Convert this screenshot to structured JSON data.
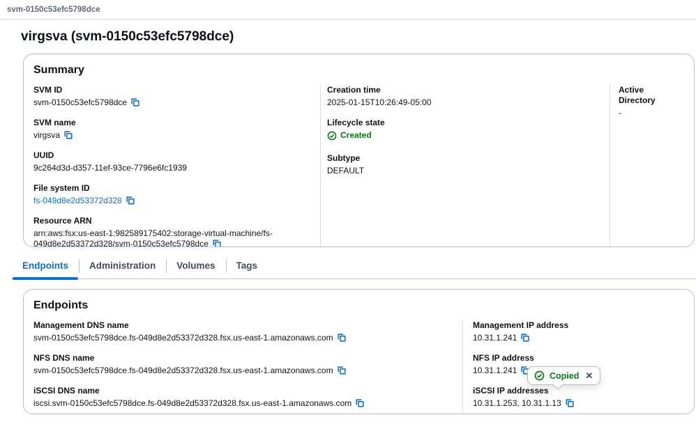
{
  "breadcrumb": {
    "current": "svm-0150c53efc5798dce"
  },
  "page_title": "virgsva (svm-0150c53efc5798dce)",
  "colors": {
    "accent": "#0972d3",
    "success": "#037f0c",
    "text": "#0f141a",
    "secondary_text": "#5f6b7a",
    "card_border": "#b6bec9",
    "divider": "#d9dde3"
  },
  "icons": {
    "copy": "copy-icon (two overlapping squares)",
    "success_check": "check-circle",
    "close": "✕"
  },
  "summary": {
    "heading": "Summary",
    "col1": [
      {
        "label": "SVM ID",
        "value": "svm-0150c53efc5798dce",
        "copy": true
      },
      {
        "label": "SVM name",
        "value": "virgsva",
        "copy": true
      },
      {
        "label": "UUID",
        "value": "9c264d3d-d357-11ef-93ce-7796e6fc1939",
        "copy": false
      },
      {
        "label": "File system ID",
        "value": "fs-049d8e2d53372d328",
        "copy": true,
        "link": true
      },
      {
        "label": "Resource ARN",
        "value": "arn:aws:fsx:us-east-1:982589175402:storage-virtual-machine/fs-049d8e2d53372d328/svm-0150c53efc5798dce",
        "copy": true
      }
    ],
    "col2": [
      {
        "label": "Creation time",
        "value": "2025-01-15T10:26:49-05:00"
      },
      {
        "label": "Lifecycle state",
        "value": "Created",
        "status": "success"
      },
      {
        "label": "Subtype",
        "value": "DEFAULT"
      }
    ],
    "col3": [
      {
        "label": "Active Directory",
        "value": "-"
      }
    ]
  },
  "tabs": [
    {
      "label": "Endpoints",
      "active": true
    },
    {
      "label": "Administration",
      "active": false
    },
    {
      "label": "Volumes",
      "active": false
    },
    {
      "label": "Tags",
      "active": false
    }
  ],
  "endpoints": {
    "heading": "Endpoints",
    "col1": [
      {
        "label": "Management DNS name",
        "value": "svm-0150c53efc5798dce.fs-049d8e2d53372d328.fsx.us-east-1.amazonaws.com",
        "copy": true
      },
      {
        "label": "NFS DNS name",
        "value": "svm-0150c53efc5798dce.fs-049d8e2d53372d328.fsx.us-east-1.amazonaws.com",
        "copy": true
      },
      {
        "label": "iSCSI DNS name",
        "value": "iscsi.svm-0150c53efc5798dce.fs-049d8e2d53372d328.fsx.us-east-1.amazonaws.com",
        "copy": true
      }
    ],
    "col2": [
      {
        "label": "Management IP address",
        "value": "10.31.1.241",
        "copy": true
      },
      {
        "label": "NFS IP address",
        "value": "10.31.1.241",
        "copy": true
      },
      {
        "label": "iSCSI IP addresses",
        "value": "10.31.1.253, 10.31.1.13",
        "copy": true
      }
    ]
  },
  "popover": {
    "message": "Copied",
    "close": "✕"
  }
}
